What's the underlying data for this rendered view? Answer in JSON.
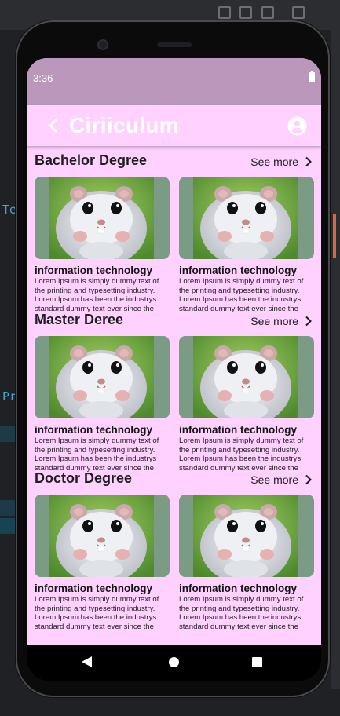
{
  "status_bar": {
    "time": "3:36"
  },
  "app_bar": {
    "title": "Ciriiculum",
    "back_icon": "arrow-back-icon",
    "profile_icon": "account-circle-icon"
  },
  "ide": {
    "left_text_1": "Te",
    "left_text_2": "Pr"
  },
  "sections": [
    {
      "title": "Bachelor Degree",
      "see_more": "See more",
      "cards": [
        {
          "title": "information technology",
          "description": "Lorem Ipsum is simply dummy text of the printing and typesetting industry. Lorem Ipsum has been the industrys standard dummy text ever since the"
        },
        {
          "title": "information technology",
          "description": "Lorem Ipsum is simply dummy text of the printing and typesetting industry. Lorem Ipsum has been the industrys standard dummy text ever since the"
        }
      ]
    },
    {
      "title": "Master Deree",
      "see_more": "See more",
      "cards": [
        {
          "title": "information technology",
          "description": "Lorem Ipsum is simply dummy text of the printing and typesetting industry. Lorem Ipsum has been the industrys standard dummy text ever since the"
        },
        {
          "title": "information technology",
          "description": "Lorem Ipsum is simply dummy text of the printing and typesetting industry. Lorem Ipsum has been the industrys standard dummy text ever since the"
        }
      ]
    },
    {
      "title": "Doctor Degree",
      "see_more": "See more",
      "cards": [
        {
          "title": "information technology",
          "description": "Lorem Ipsum is simply dummy text of the printing and typesetting industry. Lorem Ipsum has been the industrys standard dummy text ever since the"
        },
        {
          "title": "information technology",
          "description": "Lorem Ipsum is simply dummy text of the printing and typesetting industry. Lorem Ipsum has been the industrys standard dummy text ever since the"
        }
      ]
    }
  ],
  "colors": {
    "screen_background": "#ffd1ff",
    "status_bar": "#bb98bb",
    "app_title": "#ffffff"
  },
  "nav_bar": {
    "icons": [
      "nav-back-icon",
      "nav-home-icon",
      "nav-recents-icon"
    ]
  }
}
